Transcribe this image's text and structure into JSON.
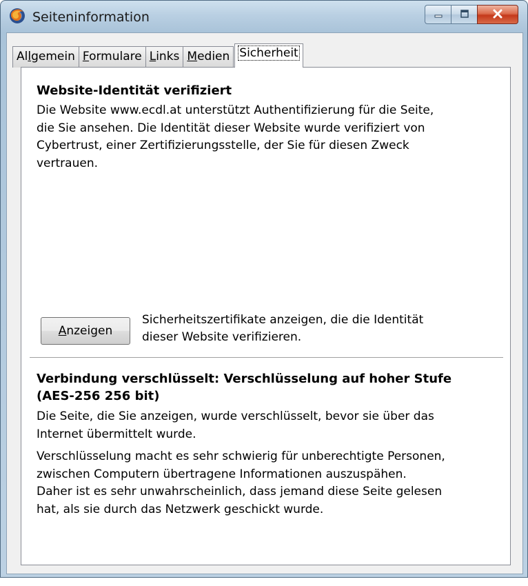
{
  "window": {
    "title": "Seiteninformation",
    "icon": "firefox-icon",
    "buttons": [
      "minimize-icon",
      "maximize-icon",
      "close-icon"
    ]
  },
  "tabs": [
    {
      "pre": "Al",
      "key": "l",
      "post": "gemein"
    },
    {
      "pre": "",
      "key": "F",
      "post": "ormulare"
    },
    {
      "pre": "",
      "key": "L",
      "post": "inks"
    },
    {
      "pre": "",
      "key": "M",
      "post": "edien"
    },
    {
      "pre": "",
      "key": "",
      "post": "Sicherheit"
    }
  ],
  "identity": {
    "heading": "Website-Identität verifiziert",
    "lines": [
      "Die Website www.ecdl.at unterstützt Authentifizierung für die Seite,",
      "die Sie ansehen. Die Identität dieser Website wurde verifiziert von",
      "Cybertrust, einer Zertifizierungsstelle, der Sie für diesen Zweck",
      "vertrauen."
    ],
    "button": {
      "key": "A",
      "rest": "nzeigen"
    },
    "button_desc": [
      "Sicherheitszertifikate anzeigen, die die Identität",
      "dieser Website verifizieren."
    ]
  },
  "connection": {
    "heading_lines": [
      "Verbindung verschlüsselt: Verschlüsselung auf hoher Stufe",
      "(AES-256 256 bit)"
    ],
    "para1": [
      "Die Seite, die Sie anzeigen, wurde verschlüsselt, bevor sie über das",
      "Internet übermittelt wurde."
    ],
    "para2": [
      "Verschlüsselung macht es sehr schwierig für unberechtigte Personen,",
      "zwischen Computern übertragene Informationen auszuspähen.",
      "Daher ist es sehr unwahrscheinlich, dass jemand diese Seite gelesen",
      "hat, als sie durch das Netzwerk geschickt wurde."
    ]
  }
}
